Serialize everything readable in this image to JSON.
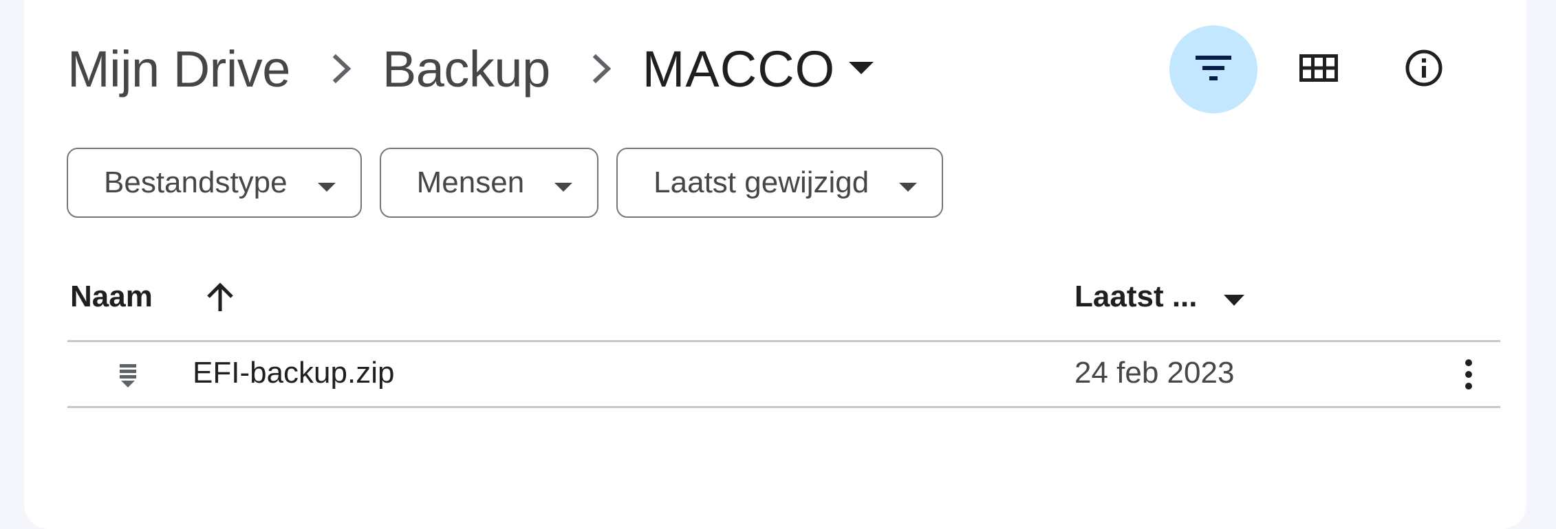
{
  "breadcrumb": {
    "items": [
      {
        "label": "Mijn Drive"
      },
      {
        "label": "Backup"
      }
    ],
    "current": "MACCO"
  },
  "toolbar": {
    "filter_icon": "filter-icon",
    "grid_icon": "grid-view-icon",
    "info_icon": "info-icon",
    "active_color": "#c2e7ff"
  },
  "filters": [
    {
      "label": "Bestandstype"
    },
    {
      "label": "Mensen"
    },
    {
      "label": "Laatst gewijzigd"
    }
  ],
  "list": {
    "columns": {
      "name": "Naam",
      "modified": "Laatst ..."
    },
    "sort": "ascending",
    "rows": [
      {
        "name": "EFI-backup.zip",
        "modified": "24 feb 2023",
        "icon": "zip-file-icon"
      }
    ]
  }
}
